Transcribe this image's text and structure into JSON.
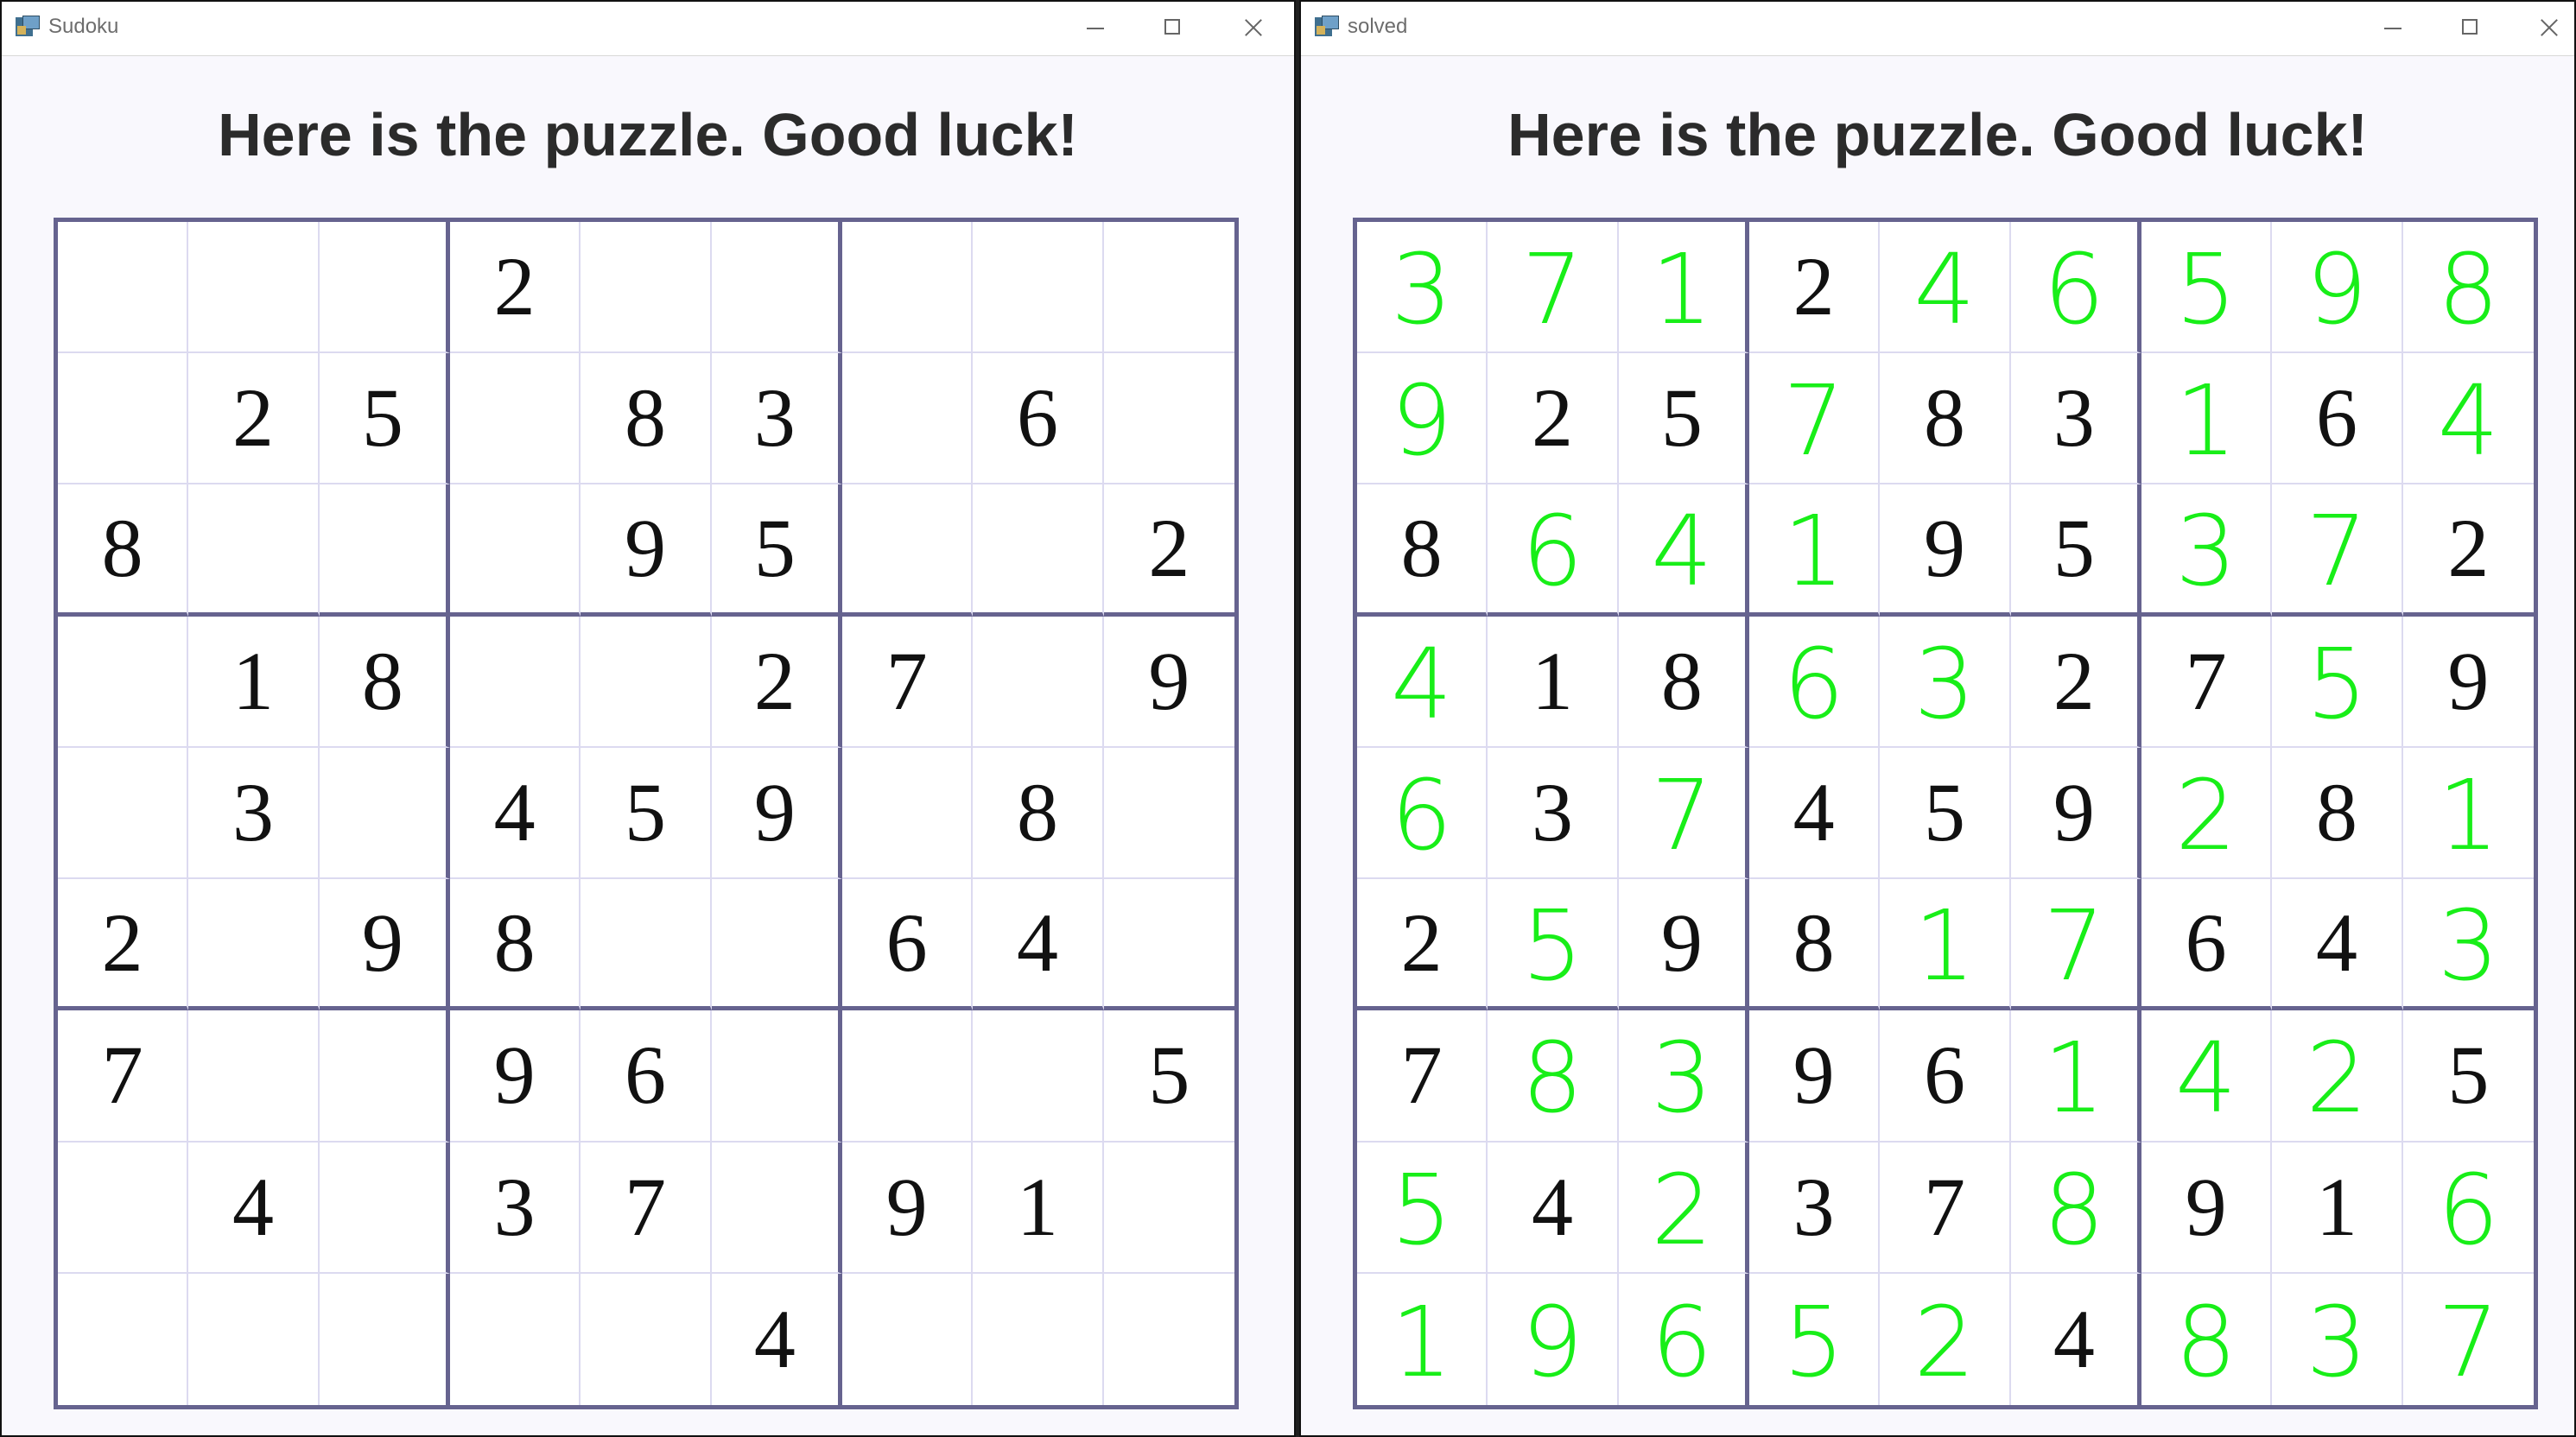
{
  "windows": [
    {
      "title": "Sudoku",
      "heading": "Here is the puzzle. Good luck!",
      "grid": [
        [
          "",
          "",
          "",
          "2",
          "",
          "",
          "",
          "",
          ""
        ],
        [
          "",
          "2",
          "5",
          "",
          "8",
          "3",
          "",
          "6",
          ""
        ],
        [
          "8",
          "",
          "",
          "",
          "9",
          "5",
          "",
          "",
          "2"
        ],
        [
          "",
          "1",
          "8",
          "",
          "",
          "2",
          "7",
          "",
          "9"
        ],
        [
          "",
          "3",
          "",
          "4",
          "5",
          "9",
          "",
          "8",
          ""
        ],
        [
          "2",
          "",
          "9",
          "8",
          "",
          "",
          "6",
          "4",
          ""
        ],
        [
          "7",
          "",
          "",
          "9",
          "6",
          "",
          "",
          "",
          "5"
        ],
        [
          "",
          "4",
          "",
          "3",
          "7",
          "",
          "9",
          "1",
          ""
        ],
        [
          "",
          "",
          "",
          "",
          "",
          "4",
          "",
          "",
          ""
        ]
      ]
    },
    {
      "title": "solved",
      "heading": "Here is the puzzle. Good luck!",
      "grid": [
        [
          "3",
          "7",
          "1",
          "2",
          "4",
          "6",
          "5",
          "9",
          "8"
        ],
        [
          "9",
          "2",
          "5",
          "7",
          "8",
          "3",
          "1",
          "6",
          "4"
        ],
        [
          "8",
          "6",
          "4",
          "1",
          "9",
          "5",
          "3",
          "7",
          "2"
        ],
        [
          "4",
          "1",
          "8",
          "6",
          "3",
          "2",
          "7",
          "5",
          "9"
        ],
        [
          "6",
          "3",
          "7",
          "4",
          "5",
          "9",
          "2",
          "8",
          "1"
        ],
        [
          "2",
          "5",
          "9",
          "8",
          "1",
          "7",
          "6",
          "4",
          "3"
        ],
        [
          "7",
          "8",
          "3",
          "9",
          "6",
          "1",
          "4",
          "2",
          "5"
        ],
        [
          "5",
          "4",
          "2",
          "3",
          "7",
          "8",
          "9",
          "1",
          "6"
        ],
        [
          "1",
          "9",
          "6",
          "5",
          "2",
          "4",
          "8",
          "3",
          "7"
        ]
      ],
      "solved_color": "#18ee18"
    }
  ],
  "icons": {
    "app": "window-app-icon",
    "minimize": "minimize-icon",
    "maximize": "maximize-icon",
    "close": "close-icon"
  },
  "colors": {
    "grid_border": "#66638f",
    "solved_digits": "#18ee18",
    "given_digits": "#111111"
  }
}
